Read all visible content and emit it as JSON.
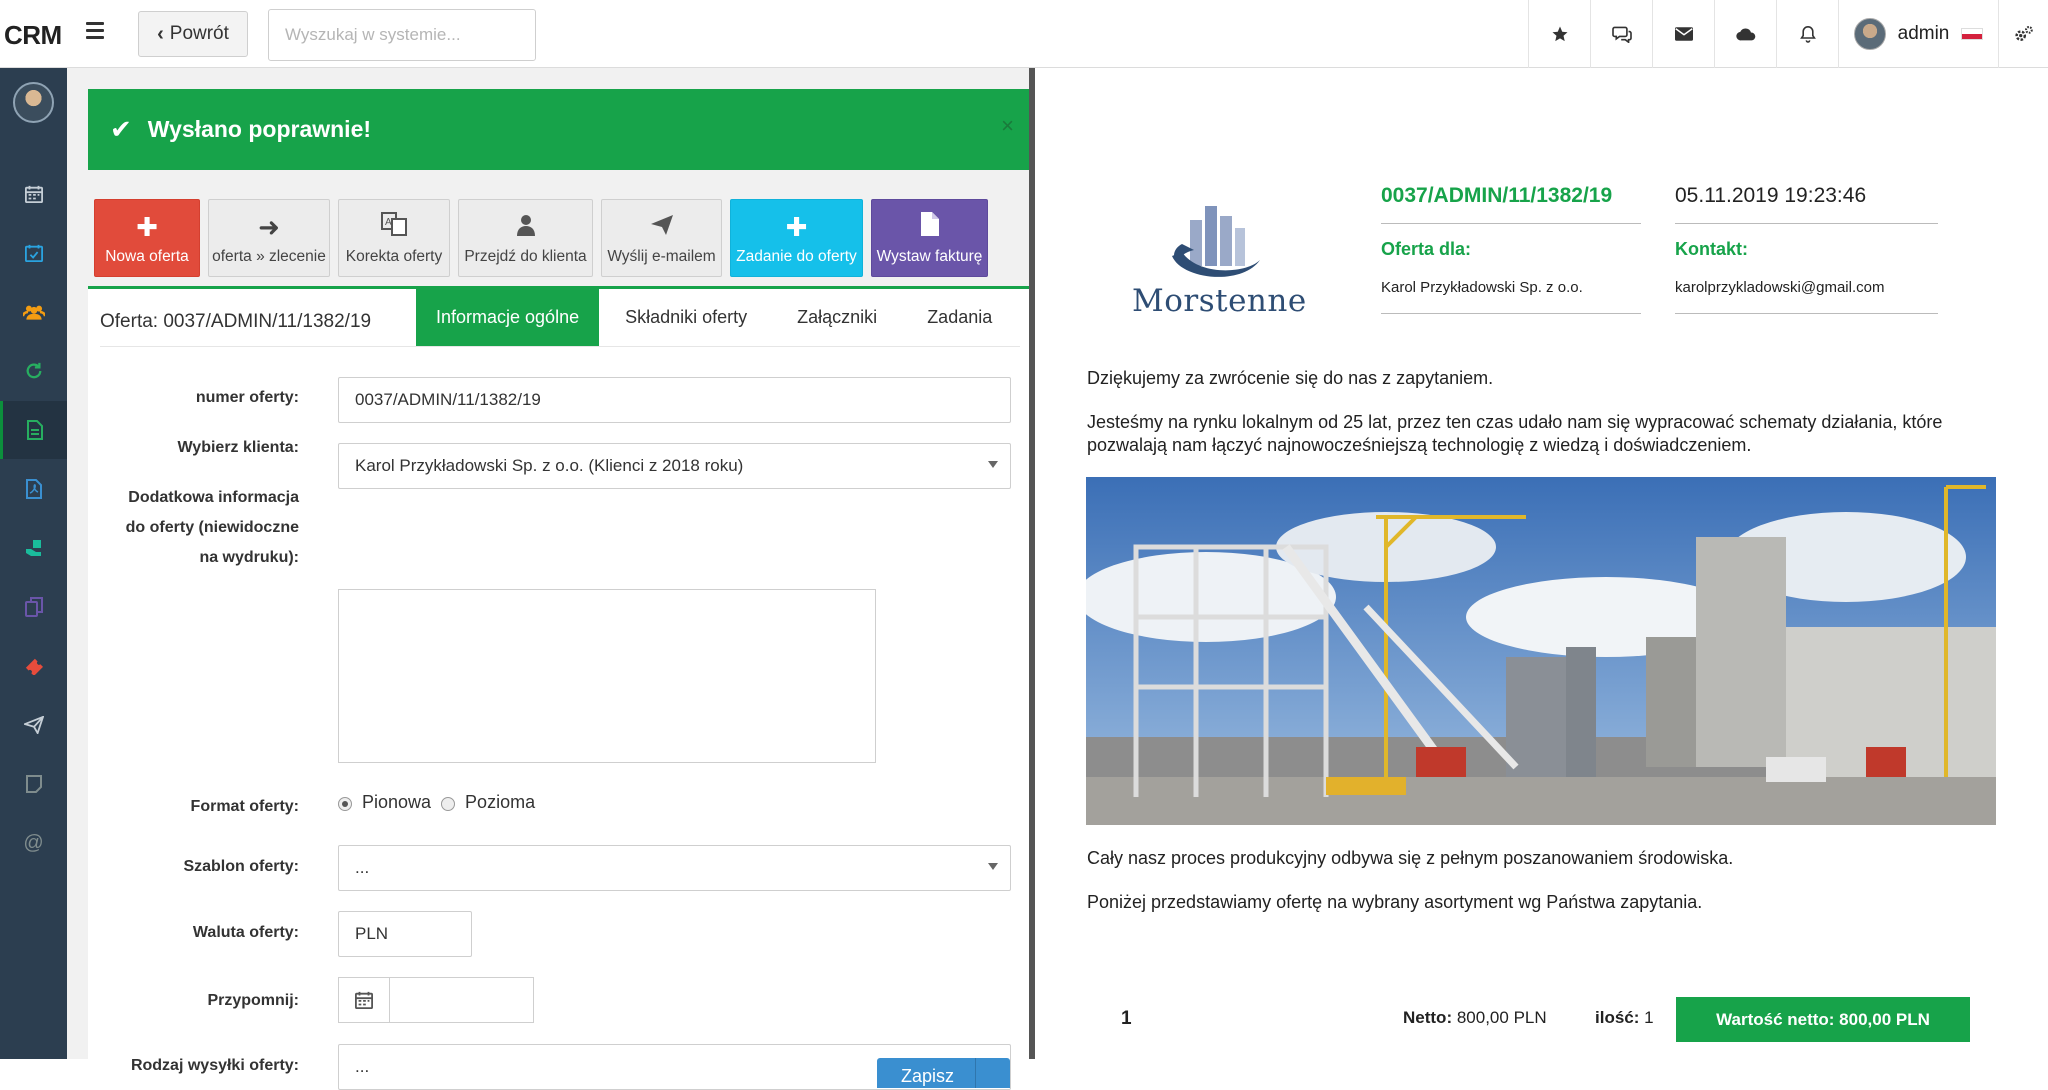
{
  "app": {
    "brand": "CRM"
  },
  "header": {
    "back_label": "Powrót",
    "search_placeholder": "Wyszukaj w systemie...",
    "user_name": "admin"
  },
  "sidebar": {
    "items": [
      "calendar-icon",
      "calendar-check-icon",
      "users-icon",
      "refresh-icon",
      "document-icon",
      "pdf-icon",
      "hand-icon",
      "copy-icon",
      "ticket-icon",
      "paper-plane-icon",
      "note-icon",
      "at-icon"
    ],
    "active_index": 4
  },
  "alert": {
    "text": "Wysłano poprawnie!",
    "close": "×"
  },
  "actions": [
    {
      "label": "Nowa oferta"
    },
    {
      "label": "oferta » zlecenie"
    },
    {
      "label": "Korekta oferty"
    },
    {
      "label": "Przejdź do klienta"
    },
    {
      "label": "Wyślij e-mailem"
    },
    {
      "label": "Zadanie do oferty"
    },
    {
      "label": "Wystaw fakturę"
    }
  ],
  "form": {
    "title": "Oferta: 0037/ADMIN/11/1382/19",
    "tabs": [
      "Informacje ogólne",
      "Składniki oferty",
      "Załączniki",
      "Zadania"
    ],
    "active_tab": 0,
    "fields": {
      "offer_number": {
        "label": "numer oferty:",
        "value": "0037/ADMIN/11/1382/19"
      },
      "client": {
        "label": "Wybierz klienta:",
        "value": "Karol Przykładowski Sp. z o.o. (Klienci z 2018 roku)"
      },
      "extra_info": {
        "label_lines": [
          "Dodatkowa informacja",
          "do oferty (niewidoczne",
          "na wydruku):"
        ],
        "value": ""
      },
      "format": {
        "label": "Format oferty:",
        "options": [
          "Pionowa",
          "Pozioma"
        ],
        "selected": "Pionowa"
      },
      "template": {
        "label": "Szablon oferty:",
        "value": "..."
      },
      "currency": {
        "label": "Waluta oferty:",
        "value": "PLN"
      },
      "reminder": {
        "label": "Przypomnij:",
        "value": ""
      },
      "shipping": {
        "label": "Rodzaj wysyłki oferty:",
        "value": "..."
      }
    },
    "save_label": "Zapisz"
  },
  "preview": {
    "company": "Morstenne",
    "offer_number": "0037/ADMIN/11/1382/19",
    "datetime": "05.11.2019 19:23:46",
    "offer_for_label": "Oferta dla:",
    "offer_for_value": "Karol Przykładowski Sp. z o.o.",
    "contact_label": "Kontakt:",
    "contact_value": "karolprzykladowski@gmail.com",
    "paragraphs": [
      "Dziękujemy za zwrócenie się do nas z zapytaniem.",
      "Jesteśmy na rynku lokalnym od 25 lat, przez ten czas udało nam się wypracować schematy działania, które pozwalają nam łączyć najnowocześniejszą technologię z wiedzą i doświadczeniem.",
      "Cały nasz proces produkcyjny odbywa się z pełnym poszanowaniem środowiska.",
      "Poniżej przedstawiamy ofertę na wybrany asortyment wg Państwa zapytania."
    ],
    "item": {
      "number": "1",
      "netto_label": "Netto:",
      "netto_value": "800,00 PLN",
      "qty_label": "ilość:",
      "qty_value": "1",
      "value_button": "Wartość netto: 800,00 PLN"
    }
  },
  "colors": {
    "accent_green": "#17a34a",
    "sidebar_bg": "#2c3e50",
    "red": "#e14b3b",
    "cyan": "#15c0ea",
    "purple": "#6a55a9"
  }
}
